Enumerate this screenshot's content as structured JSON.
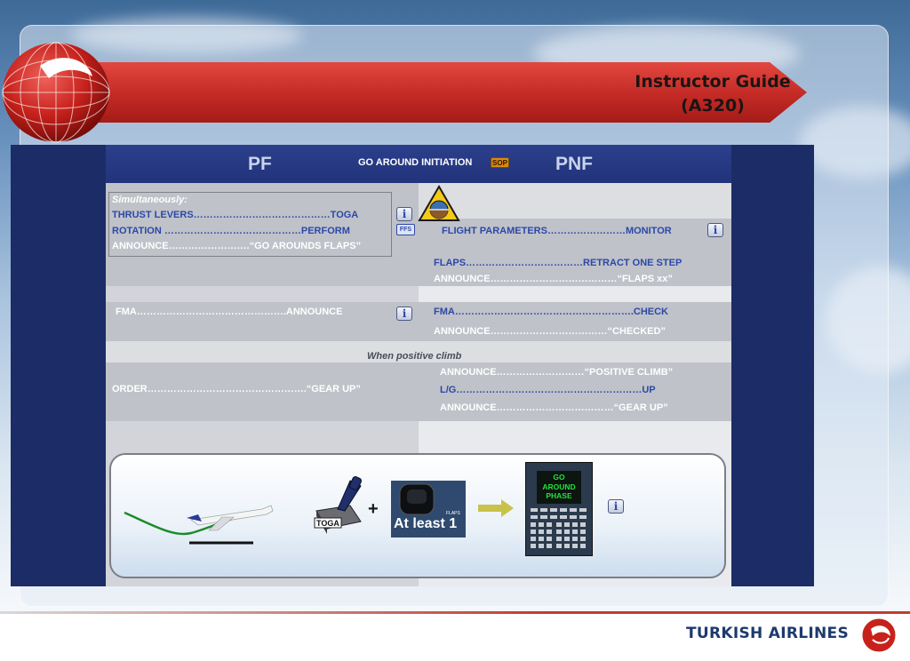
{
  "banner": {
    "title_line1": "Instructor Guide",
    "title_line2": "(A320)"
  },
  "header": {
    "pf": "PF",
    "pnf": "PNF",
    "title": "GO AROUND INITIATION",
    "sop_badge": "SOP"
  },
  "pf": {
    "simultaneously": "Simultaneously:",
    "thrust_levers": "THRUST LEVERS……………………………………TOGA",
    "rotation": "ROTATION ……………………………………PERFORM",
    "announce_flaps": "ANNOUNCE…………………….“GO AROUNDS FLAPS”",
    "fma": "FMA……………………………………….ANNOUNCE",
    "order_gear": "ORDER………………………………………….“GEAR UP”"
  },
  "pnf": {
    "flight_parameters": "FLIGHT PARAMETERS……………………MONITOR",
    "flaps": "FLAPS………………………………RETRACT ONE STEP",
    "announce_flaps_xx": "ANNOUNCE…………………………………“FLAPS xx”",
    "fma": "FMA……………………………………………….CHECK",
    "announce_checked": "ANNOUNCE………………………………“CHECKED”",
    "announce_positive": "ANNOUNCE………………………“POSITIVE CLIMB”",
    "lg": "L/G…………………………………………………UP",
    "announce_gear": "ANNOUNCE………………………………“GEAR UP”"
  },
  "when_positive_climb": "When positive climb",
  "ffs_badge": "FFS",
  "info_glyph": "i",
  "illustration": {
    "toga_label": "TOGA",
    "plus": "+",
    "flaps_caption": "At least 1",
    "flaps_small_label": "FLAPS",
    "mcdu_text": "GO\nAROUND\nPHASE"
  },
  "footer": {
    "brand": "TURKISH AIRLINES"
  },
  "colors": {
    "banner_red": "#c32a25",
    "slide_navy": "#1c2c66",
    "text_blue": "#2d48a8",
    "mcdu_green": "#22e23a"
  }
}
